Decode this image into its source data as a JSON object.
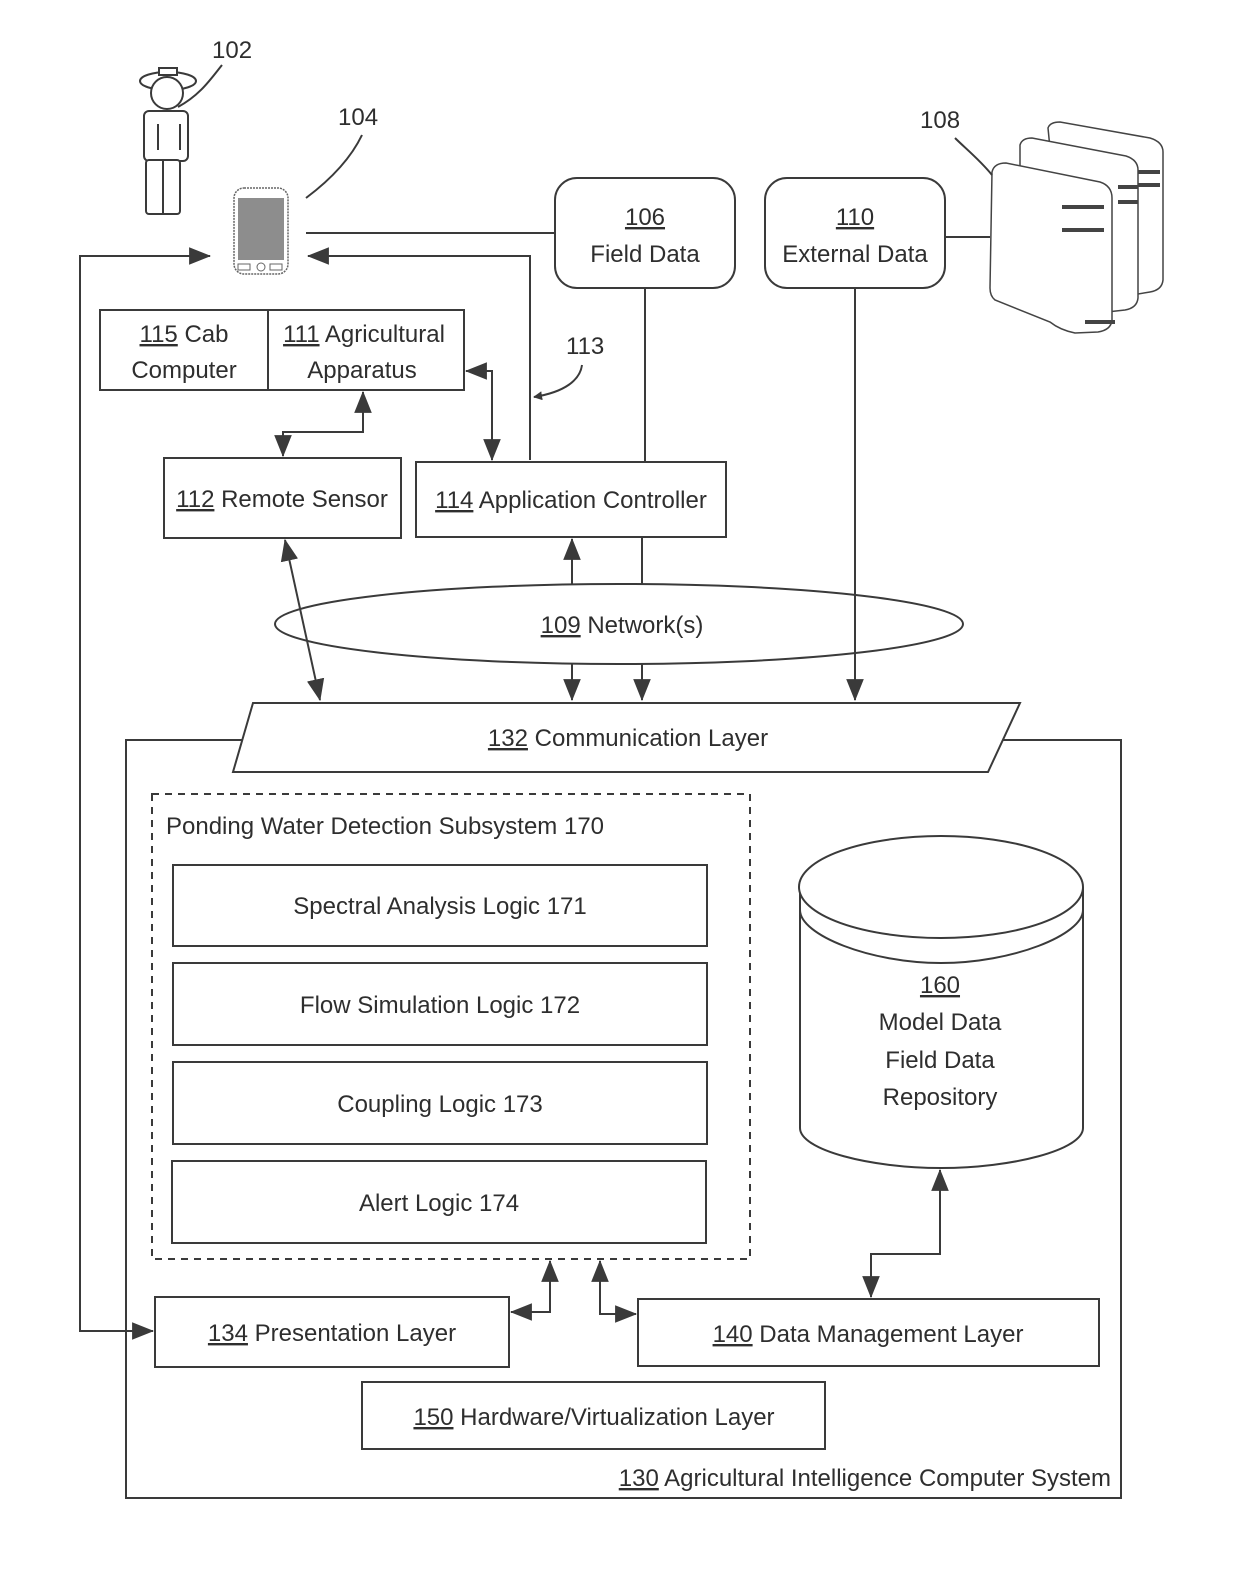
{
  "figure": {
    "user": {
      "ref": "102",
      "icon": "farmer-icon"
    },
    "mobile_device": {
      "ref": "104",
      "icon": "mobile-phone-icon"
    },
    "field_data": {
      "ref": "106",
      "label": "Field Data"
    },
    "external_data_servers": {
      "ref": "108",
      "icon": "server-rack-icon"
    },
    "external_data": {
      "ref": "110",
      "label": "External Data"
    },
    "cab_computer": {
      "ref": "115",
      "label_line1": "Cab",
      "label_line2": "Computer"
    },
    "agricultural_apparatus": {
      "ref": "111",
      "label_line1": "Agricultural",
      "label_line2": "Apparatus"
    },
    "link_113": {
      "ref": "113"
    },
    "remote_sensor": {
      "ref": "112",
      "label": "Remote Sensor"
    },
    "application_controller": {
      "ref": "114",
      "label": "Application Controller"
    },
    "networks": {
      "ref": "109",
      "label": "Network(s)"
    },
    "communication_layer": {
      "ref": "132",
      "label": "Communication Layer"
    },
    "ponding_subsystem": {
      "title": "Ponding Water Detection Subsystem 170",
      "modules": [
        {
          "label": "Spectral Analysis Logic 171"
        },
        {
          "label": "Flow Simulation Logic 172"
        },
        {
          "label": "Coupling Logic 173"
        },
        {
          "label": "Alert Logic 174"
        }
      ]
    },
    "repository": {
      "ref": "160",
      "line1": "Model Data",
      "line2": "Field Data",
      "line3": "Repository"
    },
    "presentation_layer": {
      "ref": "134",
      "label": "Presentation Layer"
    },
    "data_management_layer": {
      "ref": "140",
      "label": "Data Management Layer"
    },
    "hardware_layer": {
      "ref": "150",
      "label": "Hardware/Virtualization Layer"
    },
    "system": {
      "ref": "130",
      "label": "Agricultural Intelligence Computer System"
    }
  }
}
